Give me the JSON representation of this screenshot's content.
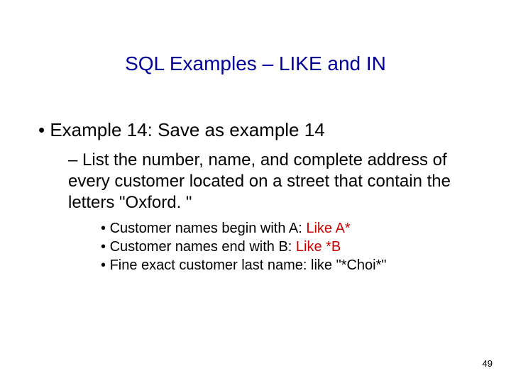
{
  "title": "SQL Examples – LIKE and IN",
  "lvl1": "Example 14: Save as example 14",
  "lvl2_prefix": "– ",
  "lvl2": "List the number, name, and complete address of every customer located on a street that contain the letters \"Oxford. \"",
  "lvl3a_text": "Customer names begin with A: ",
  "lvl3a_red": "Like A*",
  "lvl3b_text": "Customer names end with B: ",
  "lvl3b_red": "Like *B",
  "lvl3c": "Fine exact customer last name: like \"*Choi*\"",
  "page": "49"
}
